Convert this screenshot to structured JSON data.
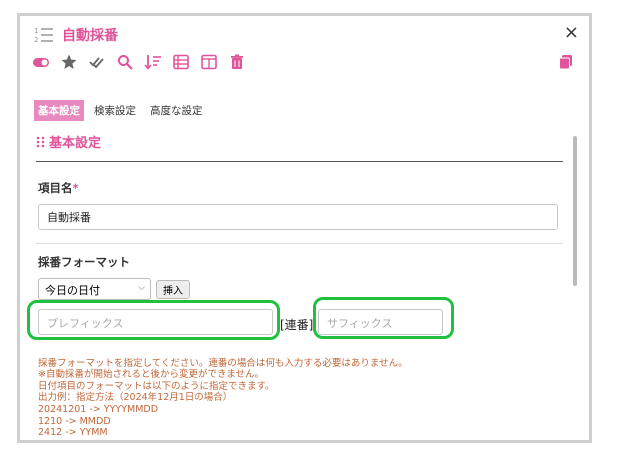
{
  "header": {
    "title": "自動採番",
    "close_glyph": "×"
  },
  "toolbar": {
    "icons": [
      "toggle-icon",
      "star-icon",
      "double-check-icon",
      "search-icon",
      "sort-icon",
      "list-icon",
      "columns-icon",
      "trash-icon"
    ],
    "copy_icon": "copy-icon"
  },
  "tabs": [
    {
      "label": "基本設定",
      "active": true
    },
    {
      "label": "検索設定",
      "active": false
    },
    {
      "label": "高度な設定",
      "active": false
    }
  ],
  "section": {
    "title": "基本設定"
  },
  "field_name": {
    "label": "項目名",
    "required_mark": "*",
    "value": "自動採番"
  },
  "format": {
    "label": "採番フォーマット",
    "select_value": "今日の日付",
    "insert_button": "挿入",
    "prefix_placeholder": "プレフィックス",
    "middle_text": "[連番]",
    "suffix_placeholder": "サフィックス"
  },
  "notes": [
    "採番フォーマットを指定してください。連番の場合は何も入力する必要はありません。",
    "※自動採番が開始されると後から変更ができません。",
    "日付項目のフォーマットは以下のように指定できます。",
    "出力例：指定方法（2024年12月1日の場合）",
    "20241201 -> YYYYMMDD",
    "1210 -> MMDD",
    "2412 -> YYMM"
  ],
  "colors": {
    "accent": "#e0559a",
    "highlight": "#20c040",
    "note_text": "#c0673a"
  }
}
